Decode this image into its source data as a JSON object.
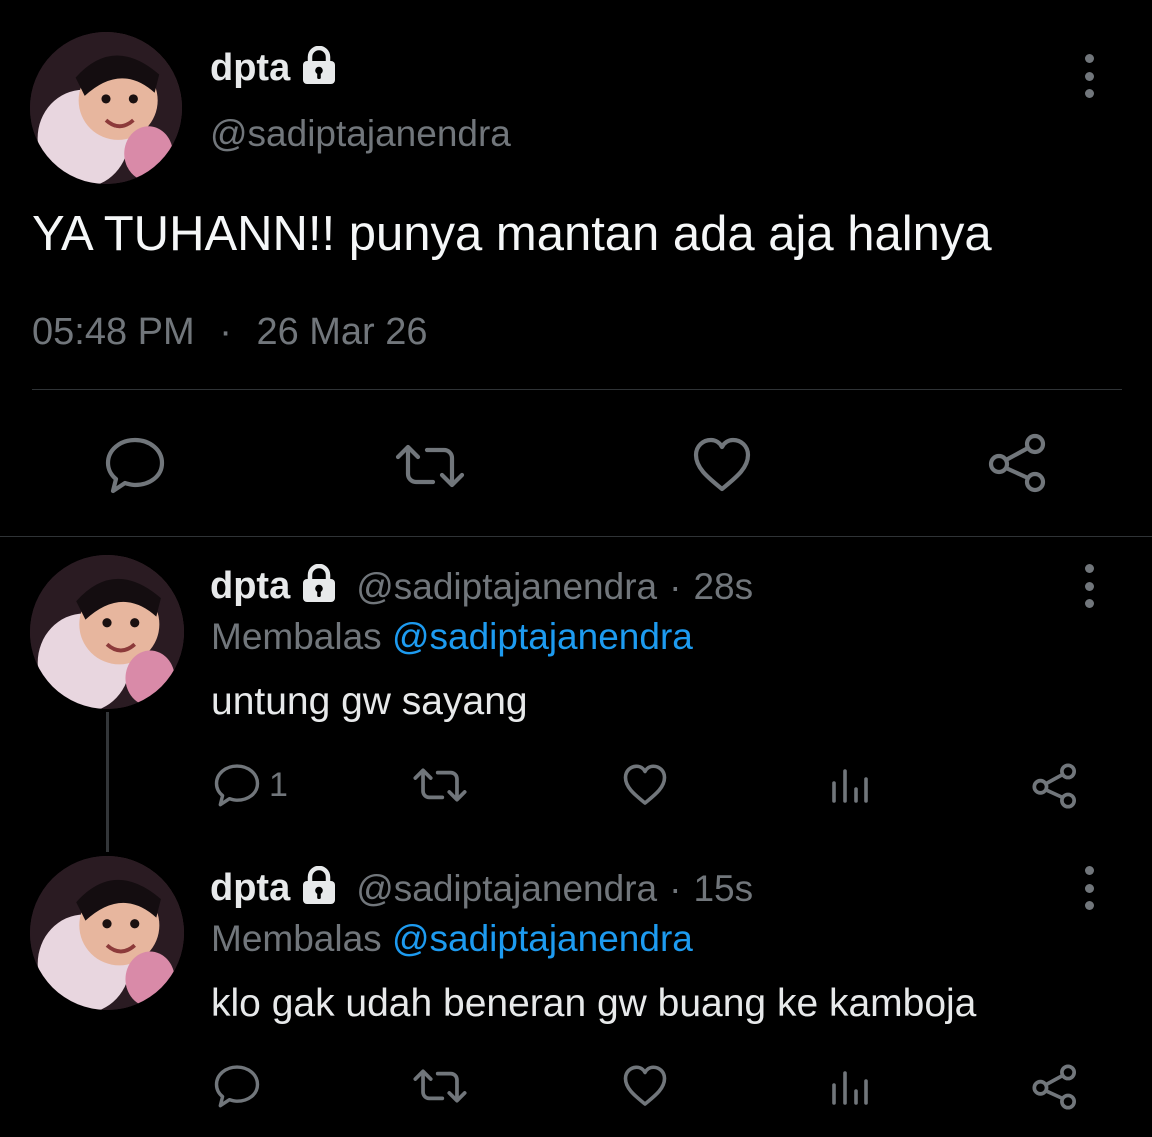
{
  "main_tweet": {
    "name": "dpta",
    "handle": "@sadiptajanendra",
    "text": "YA TUHANN!! punya mantan ada aja halnya",
    "time": "05:48 PM",
    "separator": "·",
    "date": "26 Mar 26"
  },
  "replies": [
    {
      "name": "dpta",
      "handle": "@sadiptajanendra",
      "separator": "·",
      "age": "28s",
      "reply_prefix": "Membalas",
      "reply_mention": "@sadiptajanendra",
      "text": "untung gw sayang",
      "reply_count": "1"
    },
    {
      "name": "dpta",
      "handle": "@sadiptajanendra",
      "separator": "·",
      "age": "15s",
      "reply_prefix": "Membalas",
      "reply_mention": "@sadiptajanendra",
      "text": "klo gak udah beneran gw buang ke kamboja",
      "reply_count": ""
    }
  ],
  "colors": {
    "background": "#000000",
    "text": "#e7e9ea",
    "muted": "#71767b",
    "mention": "#1d9bf0",
    "divider": "#2f3336"
  },
  "icons": [
    "lock-icon",
    "more-icon",
    "reply-icon",
    "retweet-icon",
    "like-icon",
    "share-icon",
    "analytics-icon"
  ]
}
